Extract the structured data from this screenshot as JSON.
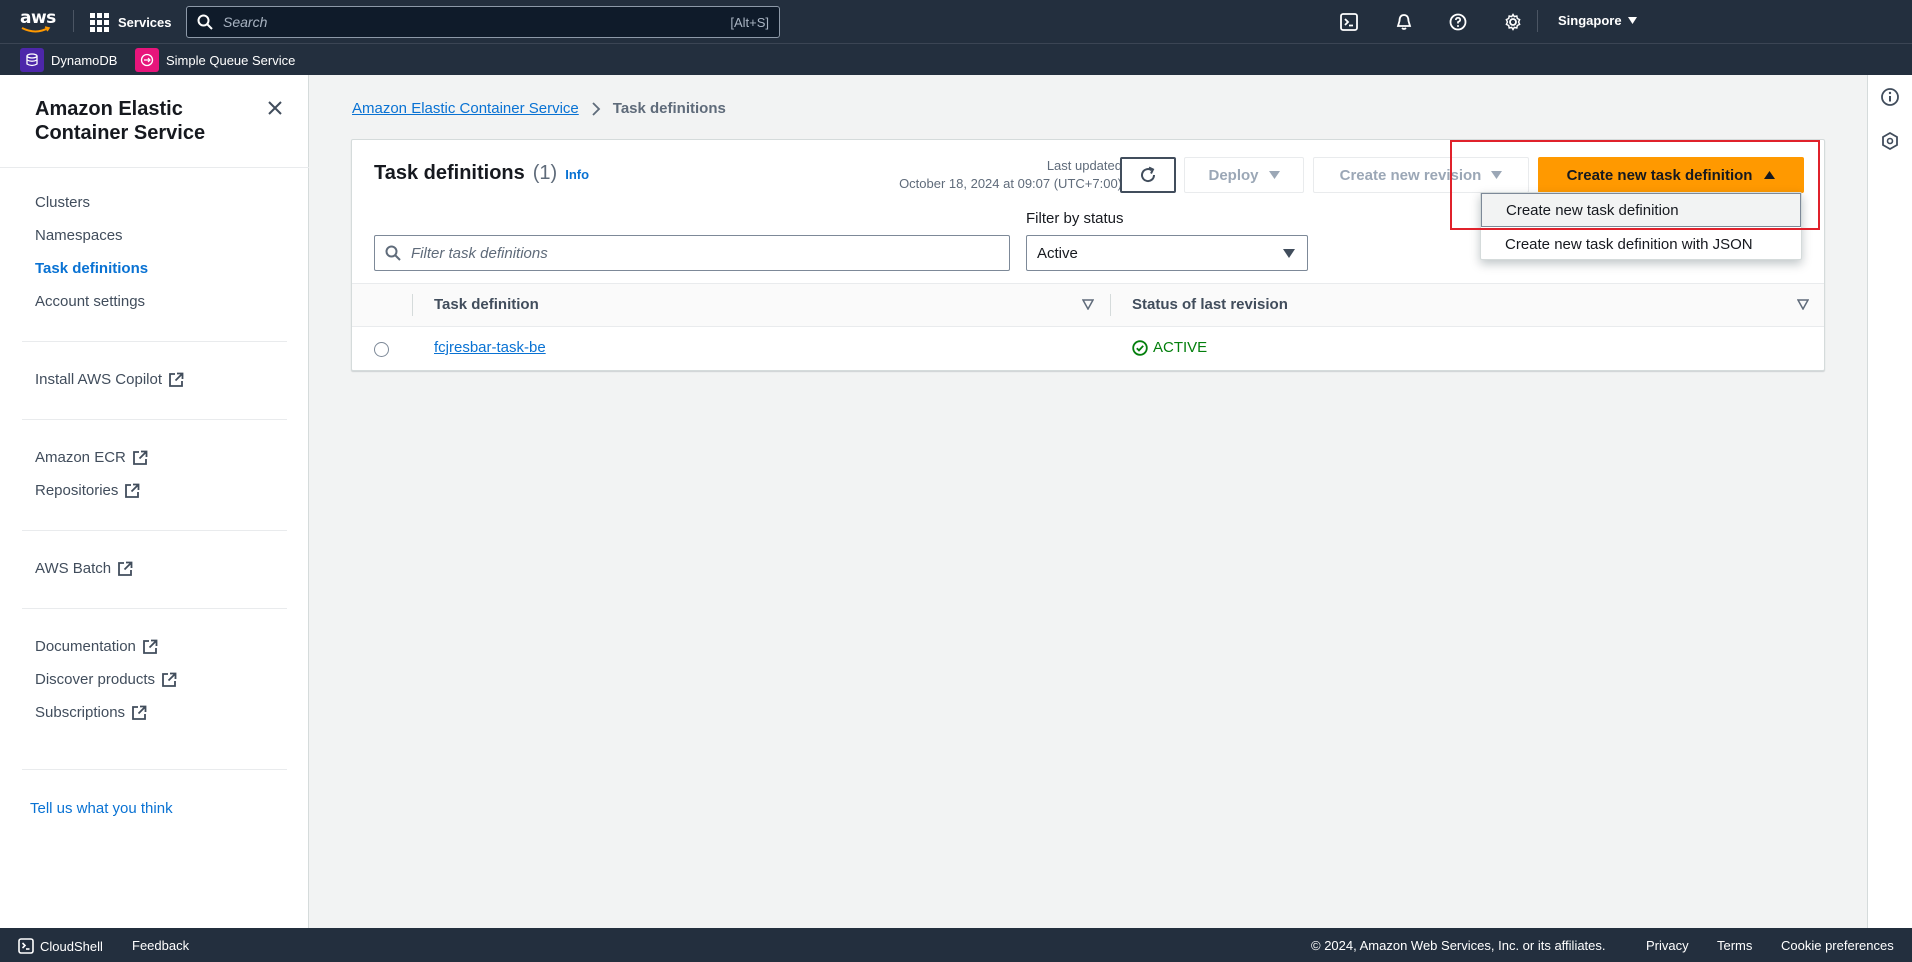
{
  "topnav": {
    "logo_text": "aws",
    "services_label": "Services",
    "search_placeholder": "Search",
    "search_shortcut": "[Alt+S]",
    "region": "Singapore",
    "favorites": [
      {
        "label": "DynamoDB",
        "color": "#4d27aa"
      },
      {
        "label": "Simple Queue Service",
        "color": "#e7157b"
      }
    ],
    "icons": [
      "cloudshell-icon",
      "bell-icon",
      "help-icon",
      "settings-icon"
    ]
  },
  "sidebar": {
    "title": "Amazon Elastic Container Service",
    "groups": [
      [
        {
          "label": "Clusters",
          "active": false,
          "external": false
        },
        {
          "label": "Namespaces",
          "active": false,
          "external": false
        },
        {
          "label": "Task definitions",
          "active": true,
          "external": false
        },
        {
          "label": "Account settings",
          "active": false,
          "external": false
        }
      ],
      [
        {
          "label": "Install AWS Copilot",
          "active": false,
          "external": true
        }
      ],
      [
        {
          "label": "Amazon ECR",
          "active": false,
          "external": true
        },
        {
          "label": "Repositories",
          "active": false,
          "external": true
        }
      ],
      [
        {
          "label": "AWS Batch",
          "active": false,
          "external": true
        }
      ],
      [
        {
          "label": "Documentation",
          "active": false,
          "external": true
        },
        {
          "label": "Discover products",
          "active": false,
          "external": true
        },
        {
          "label": "Subscriptions",
          "active": false,
          "external": true
        }
      ]
    ],
    "feedback_link": "Tell us what you think"
  },
  "breadcrumb": {
    "parent": "Amazon Elastic Container Service",
    "current": "Task definitions"
  },
  "panel": {
    "title": "Task definitions",
    "count": "(1)",
    "info": "Info",
    "last_updated_label": "Last updated",
    "last_updated_value": "October 18, 2024 at 09:07 (UTC+7:00)",
    "deploy_label": "Deploy",
    "create_revision_label": "Create new revision",
    "create_primary_label": "Create new task definition",
    "filter_placeholder": "Filter task definitions",
    "filter_status_label": "Filter by status",
    "filter_status_value": "Active",
    "columns": [
      "Task definition",
      "Status of last revision"
    ],
    "rows": [
      {
        "name": "fcjresbar-task-be",
        "status": "ACTIVE"
      }
    ]
  },
  "dropdown": {
    "items": [
      "Create new task definition",
      "Create new task definition with JSON"
    ]
  },
  "footer": {
    "cloudshell": "CloudShell",
    "feedback": "Feedback",
    "copyright": "© 2024, Amazon Web Services, Inc. or its affiliates.",
    "privacy": "Privacy",
    "terms": "Terms",
    "cookies": "Cookie preferences"
  },
  "colors": {
    "nav_bg": "#232f3e",
    "primary": "#ff9900",
    "link": "#0972d3",
    "success": "#037f0c",
    "highlight": "#e0212b"
  }
}
